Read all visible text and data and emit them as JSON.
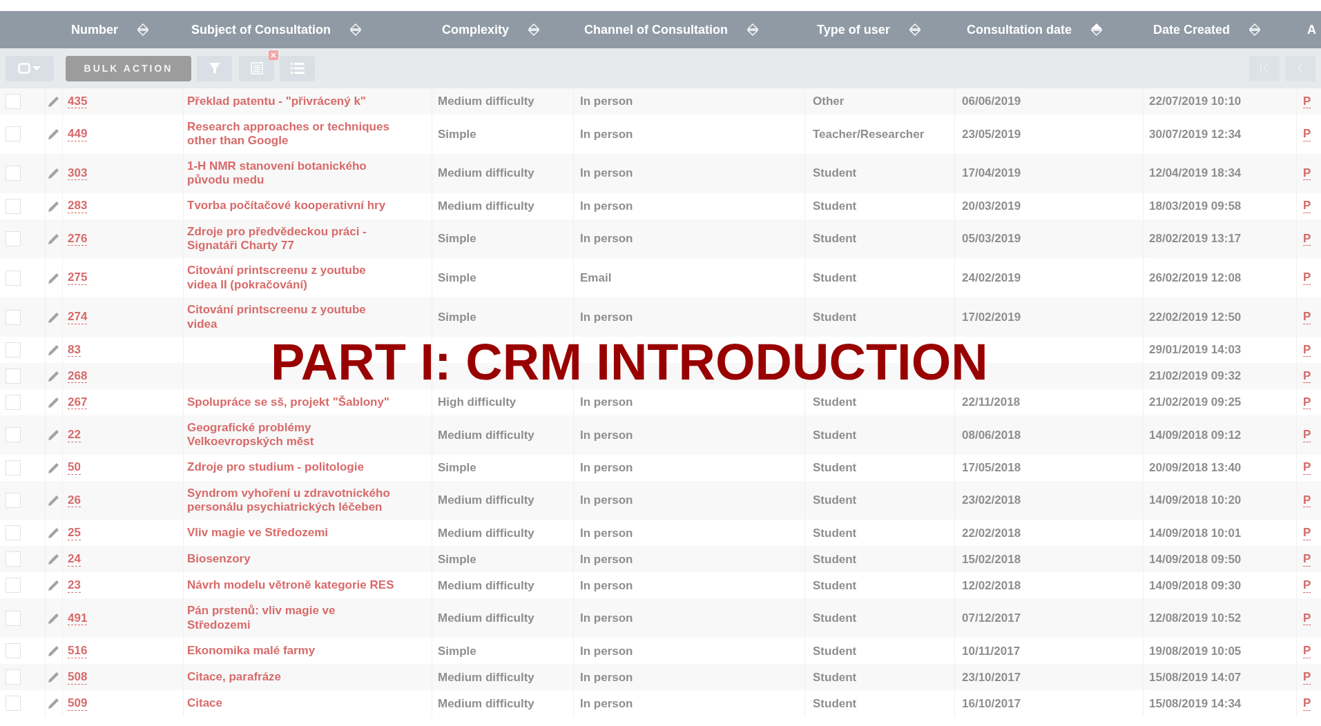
{
  "table": {
    "columns": [
      {
        "label": "Number",
        "sorted": false
      },
      {
        "label": "Subject of Consultation",
        "sorted": false
      },
      {
        "label": "Complexity",
        "sorted": false
      },
      {
        "label": "Channel of Consultation",
        "sorted": false
      },
      {
        "label": "Type of user",
        "sorted": false
      },
      {
        "label": "Consultation date",
        "sorted": true
      },
      {
        "label": "Date Created",
        "sorted": false
      },
      {
        "label": "A"
      }
    ],
    "toolbar": {
      "bulk_action": "BULK ACTION",
      "bulk_disabled": true
    },
    "rows": [
      {
        "checked": false,
        "number": "435",
        "subject": "Překlad patentu - \"přivrácený k\"",
        "complexity": "Medium difficulty",
        "channel": "In person",
        "user_type": "Other",
        "consultation_date": "06/06/2019",
        "date_created": "22/07/2019 10:10",
        "column_9": "P"
      },
      {
        "checked": false,
        "number": "449",
        "subject": "Research approaches or techniques other than Google",
        "complexity": "Simple",
        "channel": "In person",
        "user_type": "Teacher/Researcher",
        "consultation_date": "23/05/2019",
        "date_created": "30/07/2019 12:34",
        "column_9": "P"
      },
      {
        "checked": false,
        "number": "303",
        "subject": "1-H NMR stanovení botanického původu medu",
        "complexity": "Medium difficulty",
        "channel": "In person",
        "user_type": "Student",
        "consultation_date": "17/04/2019",
        "date_created": "12/04/2019 18:34",
        "column_9": "P"
      },
      {
        "checked": false,
        "number": "283",
        "subject": "Tvorba počítačové kooperativní hry",
        "complexity": "Medium difficulty",
        "channel": "In person",
        "user_type": "Student",
        "consultation_date": "20/03/2019",
        "date_created": "18/03/2019 09:58",
        "column_9": "P"
      },
      {
        "checked": false,
        "number": "276",
        "subject": "Zdroje pro předvědeckou práci - Signatáři Charty 77",
        "complexity": "Simple",
        "channel": "In person",
        "user_type": "Student",
        "consultation_date": "05/03/2019",
        "date_created": "28/02/2019 13:17",
        "column_9": "P"
      },
      {
        "checked": false,
        "number": "275",
        "subject": "Citování printscreenu z youtube videa II (pokračování)",
        "complexity": "Simple",
        "channel": "Email",
        "user_type": "Student",
        "consultation_date": "24/02/2019",
        "date_created": "26/02/2019 12:08",
        "column_9": "P"
      },
      {
        "checked": false,
        "number": "274",
        "subject": "Citování printscreenu z youtube videa",
        "complexity": "Simple",
        "channel": "In person",
        "user_type": "Student",
        "consultation_date": "17/02/2019",
        "date_created": "22/02/2019 12:50",
        "column_9": "P"
      },
      {
        "checked": false,
        "number": "83",
        "date_created": "29/01/2019 14:03",
        "column_9": "P"
      },
      {
        "checked": false,
        "number": "268",
        "date_created": "21/02/2019 09:32",
        "column_9": "P"
      },
      {
        "checked": false,
        "number": "267",
        "subject": "Spolupráce se sš, projekt \"Šablony\"",
        "complexity": "High difficulty",
        "channel": "In person",
        "user_type": "Student",
        "consultation_date": "22/11/2018",
        "date_created": "21/02/2019 09:25",
        "column_9": "P"
      },
      {
        "checked": false,
        "number": "22",
        "subject": "Geografické problémy Velkoevropských měst",
        "complexity": "Medium difficulty",
        "channel": "In person",
        "user_type": "Student",
        "consultation_date": "08/06/2018",
        "date_created": "14/09/2018 09:12",
        "column_9": "P"
      },
      {
        "checked": false,
        "number": "50",
        "subject": "Zdroje pro studium - politologie",
        "complexity": "Simple",
        "channel": "In person",
        "user_type": "Student",
        "consultation_date": "17/05/2018",
        "date_created": "20/09/2018 13:40",
        "column_9": "P"
      },
      {
        "checked": false,
        "number": "26",
        "subject": "Syndrom vyhoření u zdravotnického personálu psychiatrických léčeben",
        "complexity": "Medium difficulty",
        "channel": "In person",
        "user_type": "Student",
        "consultation_date": "23/02/2018",
        "date_created": "14/09/2018 10:20",
        "column_9": "P"
      },
      {
        "checked": false,
        "number": "25",
        "subject": "Vliv magie ve Středozemi",
        "complexity": "Medium difficulty",
        "channel": "In person",
        "user_type": "Student",
        "consultation_date": "22/02/2018",
        "date_created": "14/09/2018 10:01",
        "column_9": "P"
      },
      {
        "checked": false,
        "number": "24",
        "subject": "Biosenzory",
        "complexity": "Simple",
        "channel": "In person",
        "user_type": "Student",
        "consultation_date": "15/02/2018",
        "date_created": "14/09/2018 09:50",
        "column_9": "P"
      },
      {
        "checked": false,
        "number": "23",
        "subject": "Návrh modelu větroně kategorie RES",
        "complexity": "Medium difficulty",
        "channel": "In person",
        "user_type": "Student",
        "consultation_date": "12/02/2018",
        "date_created": "14/09/2018 09:30",
        "column_9": "P"
      },
      {
        "checked": false,
        "number": "491",
        "subject": "Pán prstenů: vliv magie ve Středozemi",
        "complexity": "Medium difficulty",
        "channel": "In person",
        "user_type": "Student",
        "consultation_date": "07/12/2017",
        "date_created": "12/08/2019 10:52",
        "column_9": "P"
      },
      {
        "checked": false,
        "number": "516",
        "subject": "Ekonomika malé farmy",
        "complexity": "Simple",
        "channel": "In person",
        "user_type": "Student",
        "consultation_date": "10/11/2017",
        "date_created": "19/08/2019 10:05",
        "column_9": "P"
      },
      {
        "checked": false,
        "number": "508",
        "subject": "Citace, parafráze",
        "complexity": "Medium difficulty",
        "channel": "In person",
        "user_type": "Student",
        "consultation_date": "23/10/2017",
        "date_created": "15/08/2019 14:07",
        "column_9": "P"
      },
      {
        "checked": false,
        "number": "509",
        "subject": "Citace",
        "complexity": "Medium difficulty",
        "channel": "In person",
        "user_type": "Student",
        "consultation_date": "16/10/2017",
        "date_created": "15/08/2019 14:34",
        "column_9": "P"
      }
    ]
  },
  "overlay_title": "PART I: CRM INTRODUCTION"
}
